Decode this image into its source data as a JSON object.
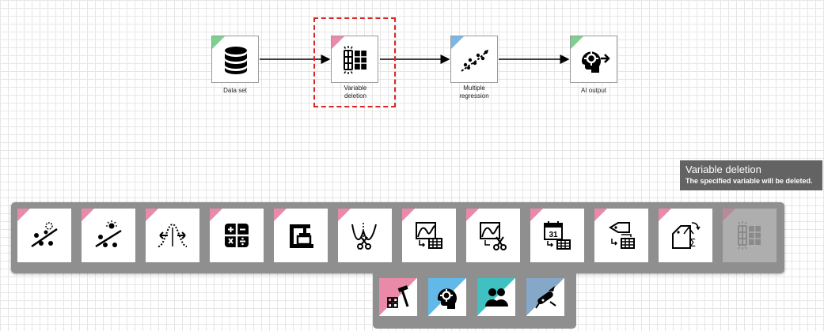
{
  "workflow": {
    "nodes": [
      {
        "id": "data-set",
        "label": "Data set",
        "icon": "database-icon",
        "accent": "#7fcf8e"
      },
      {
        "id": "variable-deletion",
        "label": "Variable deletion",
        "icon": "table-column-delete-icon",
        "accent": "#e98aa8",
        "selected": true
      },
      {
        "id": "multiple-regression",
        "label": "Multiple regression",
        "icon": "scatter-regression-icon",
        "accent": "#7ab6e8"
      },
      {
        "id": "ai-output",
        "label": "AI output",
        "icon": "ai-head-arrow-icon",
        "accent": "#7fcf8e"
      }
    ]
  },
  "tooltip": {
    "title": "Variable deletion",
    "description": "The specified variable will be deleted."
  },
  "palette": {
    "tools": [
      {
        "icon": "scatter-remove-outlier-icon"
      },
      {
        "icon": "scatter-highlight-outlier-icon"
      },
      {
        "icon": "normal-distribution-icon"
      },
      {
        "icon": "calculator-icon"
      },
      {
        "icon": "clamp-icon"
      },
      {
        "icon": "curve-cut-icon"
      },
      {
        "icon": "chart-to-table-icon"
      },
      {
        "icon": "chart-cut-icon"
      },
      {
        "icon": "calendar-to-table-icon"
      },
      {
        "icon": "tag-to-table-icon"
      },
      {
        "icon": "tag-sum-icon"
      },
      {
        "icon": "table-column-delete-icon",
        "disabled": true
      }
    ]
  },
  "categories": [
    {
      "icon": "hammer-blocks-icon",
      "accent": "#e98aa8"
    },
    {
      "icon": "ai-head-icon",
      "accent": "#62b8e6"
    },
    {
      "icon": "people-icon",
      "accent": "#40c0c0"
    },
    {
      "icon": "swiss-knife-icon",
      "accent": "#86a8c8"
    }
  ],
  "colors": {
    "accent_pink": "#e98aa8",
    "accent_green": "#7fcf8e",
    "accent_blue": "#7ab6e8",
    "selection": "#d92626",
    "panel": "#8f8f8f"
  }
}
